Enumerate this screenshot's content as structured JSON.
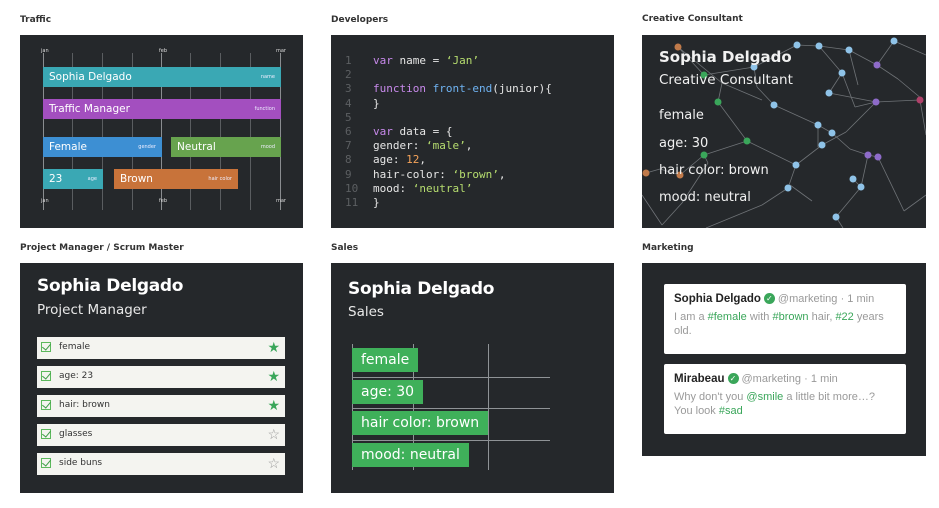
{
  "panels": {
    "traffic": "Traffic",
    "developers": "Developers",
    "creative": "Creative Consultant",
    "pm": "Project Manager / Scrum Master",
    "sales": "Sales",
    "marketing": "Marketing"
  },
  "traffic": {
    "months": [
      "jan",
      "feb",
      "mar"
    ],
    "bars": [
      {
        "label": "Sophia Delgado",
        "tag": "name",
        "color": "#3aa8b4"
      },
      {
        "label": "Traffic Manager",
        "tag": "function",
        "color": "#a34fbf"
      },
      {
        "label": "Female",
        "tag": "gender",
        "color": "#3d8fd3"
      },
      {
        "label": "Neutral",
        "tag": "mood",
        "color": "#67a34e"
      },
      {
        "label": "23",
        "tag": "age",
        "color": "#3aa8b4"
      },
      {
        "label": "Brown",
        "tag": "hair color",
        "color": "#c8733a"
      }
    ]
  },
  "developers": {
    "line_numbers": [
      "1",
      "2",
      "3",
      "4",
      "5",
      "6",
      "7",
      "8",
      "9",
      "10",
      "11"
    ],
    "code": {
      "l1_kw": "var",
      "l1_txt": " name = ",
      "l1_str": "‘Jan’",
      "l3_kw": "function",
      "l3_fn": " front-end",
      "l3_txt": "(junior){",
      "l4_txt": "}",
      "l6_kw": "var",
      "l6_txt": " data = {",
      "l7_txt": "gender: ",
      "l7_str": "‘male’",
      "l7_end": ",",
      "l8_txt": "age: ",
      "l8_num": "12",
      "l8_end": ",",
      "l9_txt": "hair-color: ",
      "l9_str": "‘brown’",
      "l9_end": ",",
      "l10_txt": "mood: ",
      "l10_str": "‘neutral’",
      "l11_txt": "}"
    }
  },
  "creative": {
    "name": "Sophia Delgado",
    "role": "Creative Consultant",
    "gender": "female",
    "age": "age: 30",
    "hair": "hair color: brown",
    "mood": "mood: neutral"
  },
  "pm": {
    "name": "Sophia Delgado",
    "role": "Project Manager",
    "items": [
      {
        "label": "female",
        "star": "★"
      },
      {
        "label": "age: 23",
        "star": "★"
      },
      {
        "label": "hair: brown",
        "star": "★"
      },
      {
        "label": "glasses",
        "star": "☆"
      },
      {
        "label": "side buns",
        "star": "☆"
      }
    ]
  },
  "sales": {
    "name": "Sophia Delgado",
    "role": "Sales",
    "tags": [
      "female",
      "age: 30",
      "hair color: brown",
      "mood: neutral"
    ]
  },
  "marketing": {
    "posts": [
      {
        "author": "Sophia Delgado",
        "handle": "@marketing",
        "time": "· 1 min",
        "b1": "I am a ",
        "b2": "#female",
        "b3": " with ",
        "b4": "#brown",
        "b5": " hair, ",
        "b6": "#22",
        "b7": " years old."
      },
      {
        "author": "Mirabeau",
        "handle": "@marketing",
        "time": "· 1 min",
        "b1": "Why don't you ",
        "b2": "@smile",
        "b3": " a little bit more…? You look ",
        "b4": "#sad"
      }
    ]
  }
}
